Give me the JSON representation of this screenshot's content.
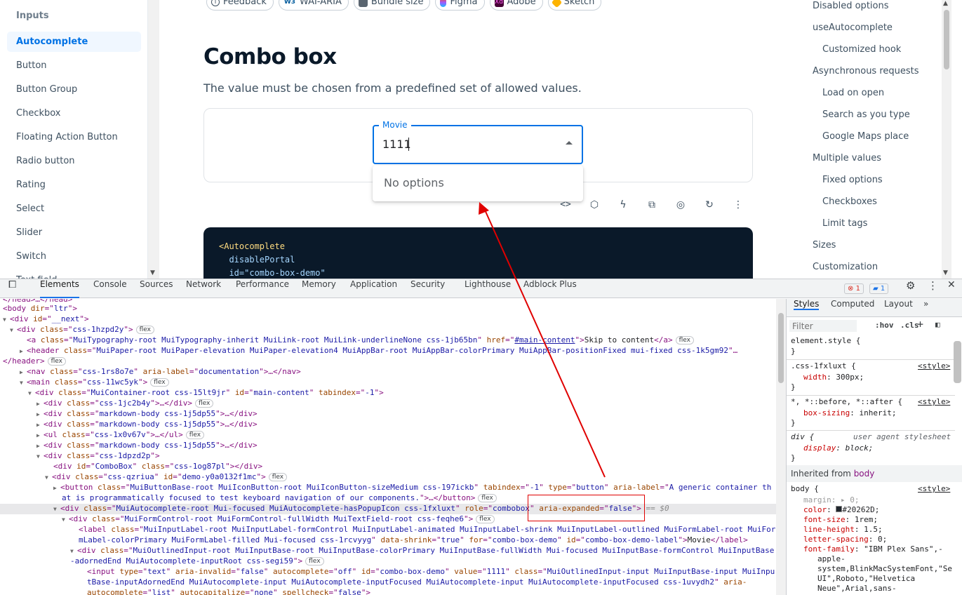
{
  "sidebar": {
    "section": "Inputs",
    "items": [
      "Autocomplete",
      "Button",
      "Button Group",
      "Checkbox",
      "Floating Action Button",
      "Radio button",
      "Rating",
      "Select",
      "Slider",
      "Switch",
      "Text field"
    ],
    "active_index": 0
  },
  "main": {
    "chips": [
      "Feedback",
      "WAI-ARIA",
      "Bundle size",
      "Figma",
      "Adobe",
      "Sketch"
    ],
    "title": "Combo box",
    "description": "The value must be chosen from a predefined set of allowed values.",
    "field_label": "Movie",
    "field_value": "1111",
    "no_options": "No options",
    "code_lines": [
      "<Autocomplete",
      "  disablePortal",
      "  id=\"combo-box-demo\""
    ]
  },
  "toc": {
    "items": [
      {
        "label": "Disabled options",
        "level": 1
      },
      {
        "label": "useAutocomplete",
        "level": 1
      },
      {
        "label": "Customized hook",
        "level": 2
      },
      {
        "label": "Asynchronous requests",
        "level": 1
      },
      {
        "label": "Load on open",
        "level": 2
      },
      {
        "label": "Search as you type",
        "level": 2
      },
      {
        "label": "Google Maps place",
        "level": 2
      },
      {
        "label": "Multiple values",
        "level": 1
      },
      {
        "label": "Fixed options",
        "level": 2
      },
      {
        "label": "Checkboxes",
        "level": 2
      },
      {
        "label": "Limit tags",
        "level": 2
      },
      {
        "label": "Sizes",
        "level": 1
      },
      {
        "label": "Customization",
        "level": 1
      }
    ]
  },
  "devtools": {
    "tabs": [
      "Elements",
      "Console",
      "Sources",
      "Network",
      "Performance",
      "Memory",
      "Application",
      "Security",
      "Lighthouse",
      "Adblock Plus"
    ],
    "errors": "1",
    "messages": "1",
    "style_tabs": [
      "Styles",
      "Computed",
      "Layout"
    ],
    "filter_placeholder": "Filter",
    "hov": ":hov",
    "cls": ".cls",
    "flex_badge": "flex",
    "dollar_zero": "== $0",
    "inherited_label": "Inherited from",
    "inherited_from": "body"
  },
  "colors": {
    "accent": "#0072e5",
    "annotation": "#e00000",
    "code_bg": "#0a1929"
  }
}
